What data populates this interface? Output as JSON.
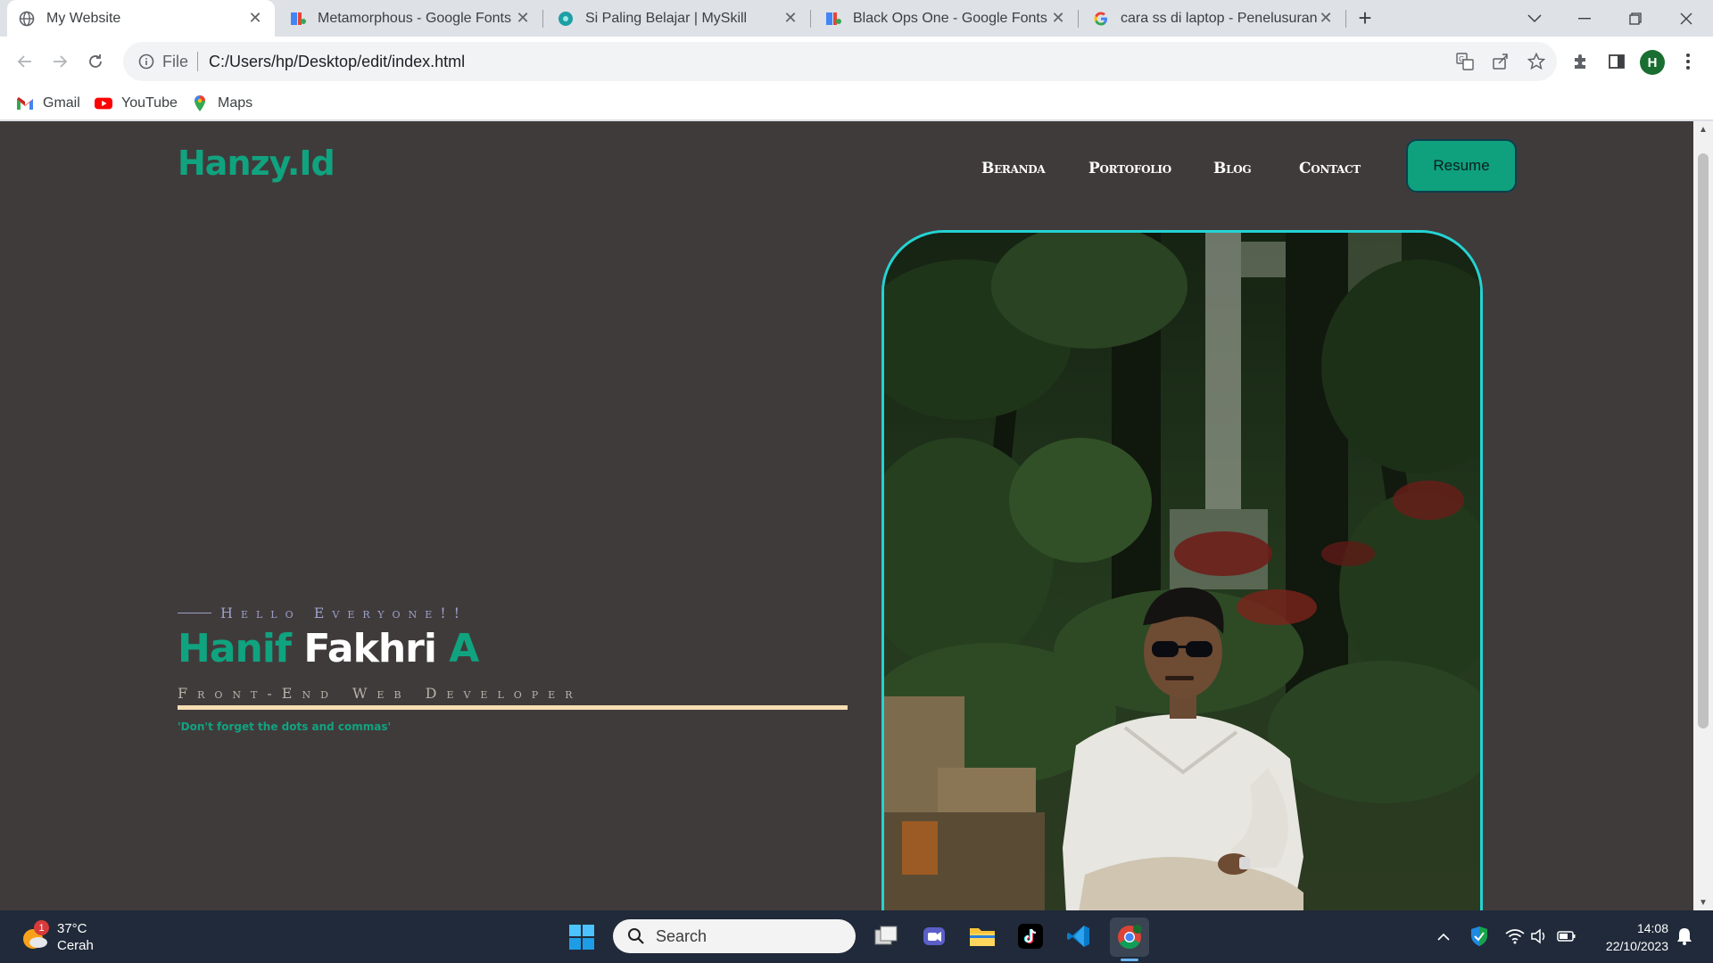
{
  "browser": {
    "tabs": [
      {
        "title": "My Website",
        "icon": "globe-icon",
        "active": true
      },
      {
        "title": "Metamorphous - Google Fonts",
        "icon": "google-fonts-icon",
        "active": false
      },
      {
        "title": "Si Paling Belajar | MySkill",
        "icon": "myskill-icon",
        "active": false
      },
      {
        "title": "Black Ops One - Google Fonts",
        "icon": "google-fonts-icon",
        "active": false
      },
      {
        "title": "cara ss di laptop - Penelusuran G",
        "icon": "google-icon",
        "active": false
      }
    ],
    "address": {
      "scheme": "File",
      "url": "C:/Users/hp/Desktop/edit/index.html"
    },
    "profile_initial": "H",
    "bookmarks": [
      {
        "label": "Gmail",
        "icon": "gmail-icon"
      },
      {
        "label": "YouTube",
        "icon": "youtube-icon"
      },
      {
        "label": "Maps",
        "icon": "maps-icon"
      }
    ]
  },
  "site": {
    "brand": "Hanzy.Id",
    "nav": [
      "Beranda",
      "Portofolio",
      "Blog",
      "Contact"
    ],
    "resume_label": "Resume",
    "hero": {
      "greeting": "Hello Everyone!!",
      "name_first": "Hanif",
      "name_middle": "Fakhri",
      "name_last": "A",
      "role": "Front-End Web Developer",
      "quote": "'Don't forget the dots and commas'"
    }
  },
  "taskbar": {
    "weather": {
      "temp": "37°C",
      "condition": "Cerah",
      "badge": "1"
    },
    "search_placeholder": "Search",
    "time": "14:08",
    "date": "22/10/2023"
  },
  "colors": {
    "page_bg": "#403b3b",
    "accent_green": "#10a37f",
    "frame_cyan": "#24d3d3",
    "underline": "#f5deb3"
  }
}
